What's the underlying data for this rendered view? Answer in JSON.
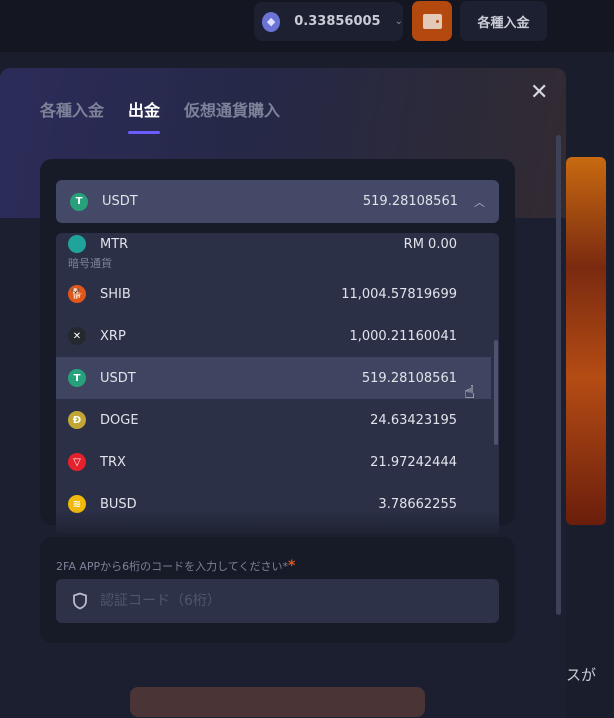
{
  "header": {
    "balance": "0.33856005",
    "deposit_label": "各種入金"
  },
  "modal": {
    "tabs": [
      "各種入金",
      "出金",
      "仮想通貨購入"
    ],
    "active_tab": "出金"
  },
  "selected": {
    "name": "USDT",
    "value": "519.28108561"
  },
  "dropdown": {
    "partial_item": {
      "name": "MTR",
      "value": "RM 0.00"
    },
    "group_label": "暗号通貨",
    "items": [
      {
        "name": "SHIB",
        "value": "11,004.57819699",
        "color": "#e0561b"
      },
      {
        "name": "XRP",
        "value": "1,000.21160041",
        "color": "#23292f"
      },
      {
        "name": "USDT",
        "value": "519.28108561",
        "color": "#26a17b"
      },
      {
        "name": "DOGE",
        "value": "24.63423195",
        "color": "#c2a633"
      },
      {
        "name": "TRX",
        "value": "21.97242444",
        "color": "#e5212b"
      },
      {
        "name": "BUSD",
        "value": "3.78662255",
        "color": "#f0b90b"
      }
    ]
  },
  "twofa": {
    "label": "2FA APPから6桁のコードを入力してください*",
    "required_mark": "*",
    "placeholder": "認証コード（6桁）"
  },
  "side_text": "スが"
}
